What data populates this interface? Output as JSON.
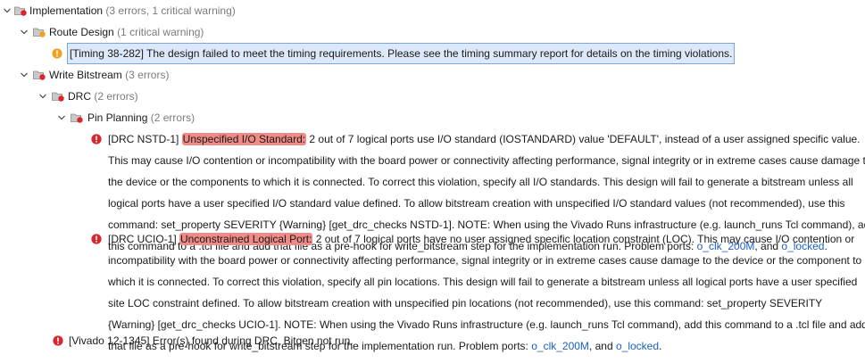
{
  "tree": {
    "implementation": {
      "label": "Implementation",
      "count": "(3 errors, 1 critical warning)"
    },
    "route_design": {
      "label": "Route Design",
      "count": "(1 critical warning)"
    },
    "timing_warning": "[Timing 38-282] The design failed to meet the timing requirements. Please see the timing summary report for details on the timing violations.",
    "write_bitstream": {
      "label": "Write Bitstream",
      "count": "(3 errors)"
    },
    "drc": {
      "label": "DRC",
      "count": "(2 errors)"
    },
    "pin_planning": {
      "label": "Pin Planning",
      "count": "(2 errors)"
    },
    "nstd": {
      "prefix": "[DRC NSTD-1] ",
      "title": "Unspecified I/O Standard:",
      "l1": " 2 out of 7 logical ports use I/O standard (IOSTANDARD) value 'DEFAULT', instead of a user assigned specific value.",
      "l2": "This may cause I/O contention or incompatibility with the board power or connectivity affecting performance, signal integrity or in extreme cases cause damage to",
      "l3": "the device or the components to which it is connected. To correct this violation, specify all I/O standards. This design will fail to generate a bitstream unless all",
      "l4": "logical ports have a user specified I/O standard value defined. To allow bitstream creation with unspecified I/O standard values (not recommended), use this",
      "l5": "command: set_property SEVERITY {Warning} [get_drc_checks NSTD-1]. NOTE: When using the Vivado Runs infrastructure (e.g. launch_runs Tcl command), add",
      "l6": " this command to a .tcl file and add that file as a pre-hook for write_bitstream step for the implementation run. Problem ports: ",
      "port1": "o_clk_200M",
      "sep": ", and ",
      "port2": "o_locked",
      "end": "."
    },
    "ucio": {
      "prefix": "[DRC UCIO-1] ",
      "title": "Unconstrained Logical Port:",
      "l1": " 2 out of 7 logical ports have no user assigned specific location constraint (LOC). This may cause I/O contention or",
      "l2": "incompatibility with the board power or connectivity affecting performance, signal integrity or in extreme cases cause damage to the device or the component to",
      "l3": "which it is connected. To correct this violation, specify all pin locations. This design will fail to generate a bitstream unless all logical ports have a user specified",
      "l4": "site LOC constraint defined. To allow bitstream creation with unspecified pin locations (not recommended), use this command: set_property SEVERITY",
      "l5": "{Warning} [get_drc_checks UCIO-1]. NOTE: When using the Vivado Runs infrastructure (e.g. launch_runs Tcl command), add this command to a .tcl file and add",
      "l6": "that file as a pre-hook for write_bitstream step for the implementation run. Problem ports: ",
      "port1": "o_clk_200M",
      "sep": ", and ",
      "port2": "o_locked",
      "end": "."
    },
    "vivado_error": "[Vivado 12-1345] Error(s) found during DRC. Bitgen not run."
  },
  "colors": {
    "error": "#d9262c",
    "warning": "#f0a21c",
    "highlight": "#f08a86",
    "link": "#1a5fc7",
    "selection": "#dbe9fb"
  },
  "icons": {
    "expand": "chevron-down-icon",
    "folder": "folder-error-icon",
    "warning": "critical-warning-icon",
    "error": "error-icon"
  }
}
